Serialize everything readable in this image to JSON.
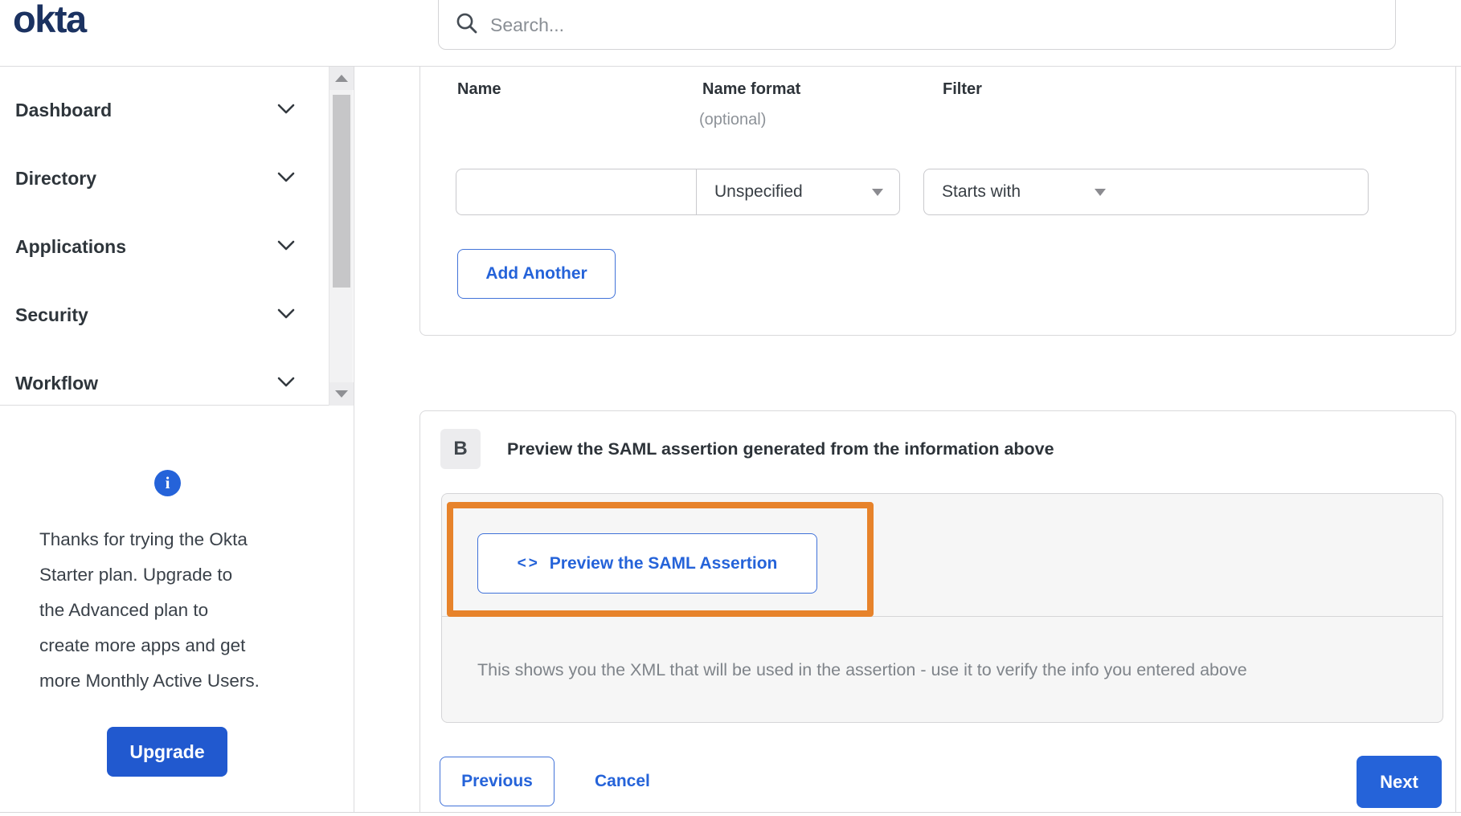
{
  "brand": {
    "logo_text": "okta",
    "logo_color": "#1b3261"
  },
  "search": {
    "placeholder": "Search..."
  },
  "sidebar": {
    "items": [
      {
        "label": "Dashboard"
      },
      {
        "label": "Directory"
      },
      {
        "label": "Applications"
      },
      {
        "label": "Security"
      },
      {
        "label": "Workflow"
      }
    ],
    "upsell": {
      "info_glyph": "i",
      "lines": [
        "Thanks for trying the Okta",
        "Starter plan. Upgrade to",
        "the Advanced plan to",
        "create more apps and get",
        "more Monthly Active Users."
      ],
      "button_label": "Upgrade"
    }
  },
  "form": {
    "columns": {
      "name": "Name",
      "name_format": "Name format",
      "name_format_note": "(optional)",
      "filter": "Filter"
    },
    "name_value": "",
    "name_format_selected": "Unspecified",
    "filter_op_selected": "Starts with",
    "filter_value": "",
    "add_another_label": "Add Another"
  },
  "section_b": {
    "badge": "B",
    "title": "Preview the SAML assertion generated from the information above",
    "preview_icon_glyph": "<>",
    "preview_button_label": "Preview the SAML Assertion",
    "description": "This shows you the XML that will be used in the assertion - use it to verify the info you entered above"
  },
  "footer": {
    "previous_label": "Previous",
    "cancel_label": "Cancel",
    "next_label": "Next"
  },
  "colors": {
    "accent_blue": "#2563d9",
    "solid_button_blue": "#2159cf",
    "annotation_orange": "#e7832b",
    "panel_gray": "#f6f6f6"
  }
}
